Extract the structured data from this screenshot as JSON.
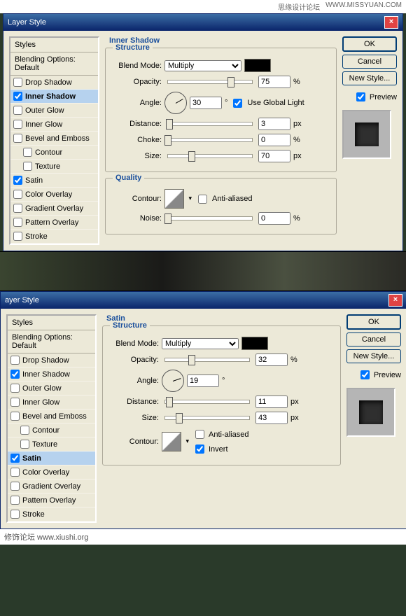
{
  "watermark_top": {
    "left": "思缘设计论坛",
    "right": "WWW.MISSYUAN.COM"
  },
  "watermark_bottom": "修饰论坛  www.xiushi.org",
  "dialog1": {
    "title": "Layer Style",
    "styles_header": "Styles",
    "blending": "Blending Options: Default",
    "items": [
      {
        "label": "Drop Shadow",
        "checked": false
      },
      {
        "label": "Inner Shadow",
        "checked": true,
        "selected": true
      },
      {
        "label": "Outer Glow",
        "checked": false
      },
      {
        "label": "Inner Glow",
        "checked": false
      },
      {
        "label": "Bevel and Emboss",
        "checked": false
      },
      {
        "label": "Contour",
        "checked": false,
        "indent": true
      },
      {
        "label": "Texture",
        "checked": false,
        "indent": true
      },
      {
        "label": "Satin",
        "checked": true
      },
      {
        "label": "Color Overlay",
        "checked": false
      },
      {
        "label": "Gradient Overlay",
        "checked": false
      },
      {
        "label": "Pattern Overlay",
        "checked": false
      },
      {
        "label": "Stroke",
        "checked": false
      }
    ],
    "panel_title": "Inner Shadow",
    "structure": {
      "legend": "Structure",
      "blend_mode_label": "Blend Mode:",
      "blend_mode": "Multiply",
      "opacity_label": "Opacity:",
      "opacity": "75",
      "angle_label": "Angle:",
      "angle": "30",
      "use_global": "Use Global Light",
      "distance_label": "Distance:",
      "distance": "3",
      "distance_unit": "px",
      "choke_label": "Choke:",
      "choke": "0",
      "choke_unit": "%",
      "size_label": "Size:",
      "size": "70",
      "size_unit": "px",
      "deg": "°",
      "pct": "%"
    },
    "quality": {
      "legend": "Quality",
      "contour_label": "Contour:",
      "anti": "Anti-aliased",
      "noise_label": "Noise:",
      "noise": "0",
      "pct": "%"
    },
    "buttons": {
      "ok": "OK",
      "cancel": "Cancel",
      "newstyle": "New Style...",
      "preview": "Preview"
    }
  },
  "dialog2": {
    "title": "ayer Style",
    "styles_header": "Styles",
    "blending": "Blending Options: Default",
    "items": [
      {
        "label": "Drop Shadow",
        "checked": false
      },
      {
        "label": "Inner Shadow",
        "checked": true
      },
      {
        "label": "Outer Glow",
        "checked": false
      },
      {
        "label": "Inner Glow",
        "checked": false
      },
      {
        "label": "Bevel and Emboss",
        "checked": false
      },
      {
        "label": "Contour",
        "checked": false,
        "indent": true
      },
      {
        "label": "Texture",
        "checked": false,
        "indent": true
      },
      {
        "label": "Satin",
        "checked": true,
        "selected": true
      },
      {
        "label": "Color Overlay",
        "checked": false
      },
      {
        "label": "Gradient Overlay",
        "checked": false
      },
      {
        "label": "Pattern Overlay",
        "checked": false
      },
      {
        "label": "Stroke",
        "checked": false
      }
    ],
    "panel_title": "Satin",
    "structure": {
      "legend": "Structure",
      "blend_mode_label": "Blend Mode:",
      "blend_mode": "Multiply",
      "opacity_label": "Opacity:",
      "opacity": "32",
      "angle_label": "Angle:",
      "angle": "19",
      "distance_label": "Distance:",
      "distance": "11",
      "distance_unit": "px",
      "size_label": "Size:",
      "size": "43",
      "size_unit": "px",
      "contour_label": "Contour:",
      "anti": "Anti-aliased",
      "invert": "Invert",
      "deg": "°",
      "pct": "%"
    },
    "buttons": {
      "ok": "OK",
      "cancel": "Cancel",
      "newstyle": "New Style...",
      "preview": "Preview"
    }
  }
}
